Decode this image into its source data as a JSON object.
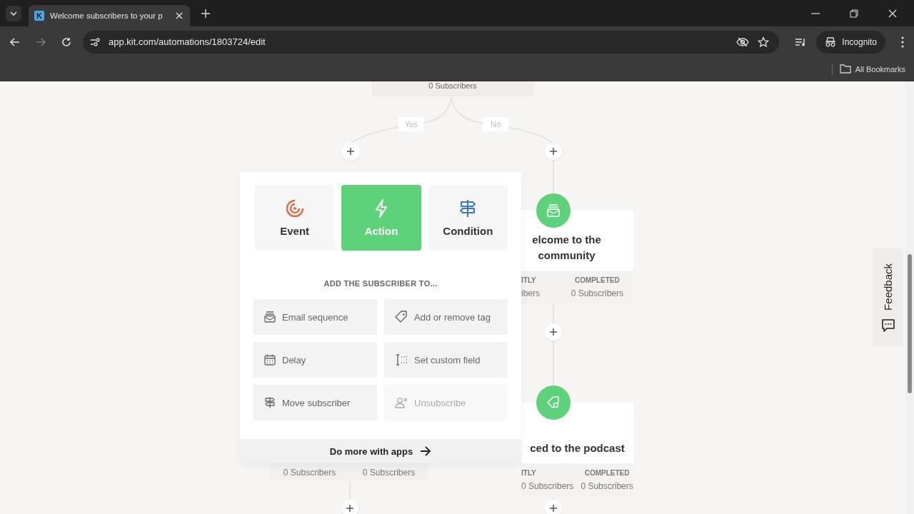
{
  "browser": {
    "tab": {
      "favicon_letter": "K",
      "title": "Welcome subscribers to your p"
    },
    "url": "app.kit.com/automations/1803724/edit",
    "profile": "Incognito",
    "bookmarks": "All Bookmarks"
  },
  "canvas": {
    "top_node": {
      "stat": "0 Subscribers"
    },
    "branches": [
      "Yes",
      "No"
    ],
    "nodes": [
      {
        "kind": "sequence",
        "title": "elcome to the community",
        "stats": [
          {
            "label": "ITLY",
            "value": "ibers"
          },
          {
            "label": "COMPLETED",
            "value": "0 Subscribers"
          }
        ]
      },
      {
        "kind": "tag",
        "title": "ced to the podcast",
        "stats": [
          {
            "label": "ITLY",
            "value": "0 Subscribers"
          },
          {
            "label": "COMPLETED",
            "value": "0 Subscribers"
          }
        ]
      }
    ],
    "hidden_node_stats": [
      "0 Subscribers",
      "0 Subscribers"
    ]
  },
  "popup": {
    "tabs": [
      {
        "label": "Event",
        "kind": "event",
        "selected": false
      },
      {
        "label": "Action",
        "kind": "action",
        "selected": true
      },
      {
        "label": "Condition",
        "kind": "condition",
        "selected": false
      }
    ],
    "heading": "ADD THE SUBSCRIBER TO...",
    "options": [
      {
        "label": "Email sequence",
        "kind": "sequence",
        "disabled": false
      },
      {
        "label": "Add or remove tag",
        "kind": "tag",
        "disabled": false
      },
      {
        "label": "Delay",
        "kind": "delay",
        "disabled": false
      },
      {
        "label": "Set custom field",
        "kind": "field",
        "disabled": false
      },
      {
        "label": "Move subscriber",
        "kind": "move",
        "disabled": false
      },
      {
        "label": "Unsubscribe",
        "kind": "unsubscribe",
        "disabled": true
      }
    ],
    "footer": "Do more with apps"
  },
  "feedback": "Feedback"
}
